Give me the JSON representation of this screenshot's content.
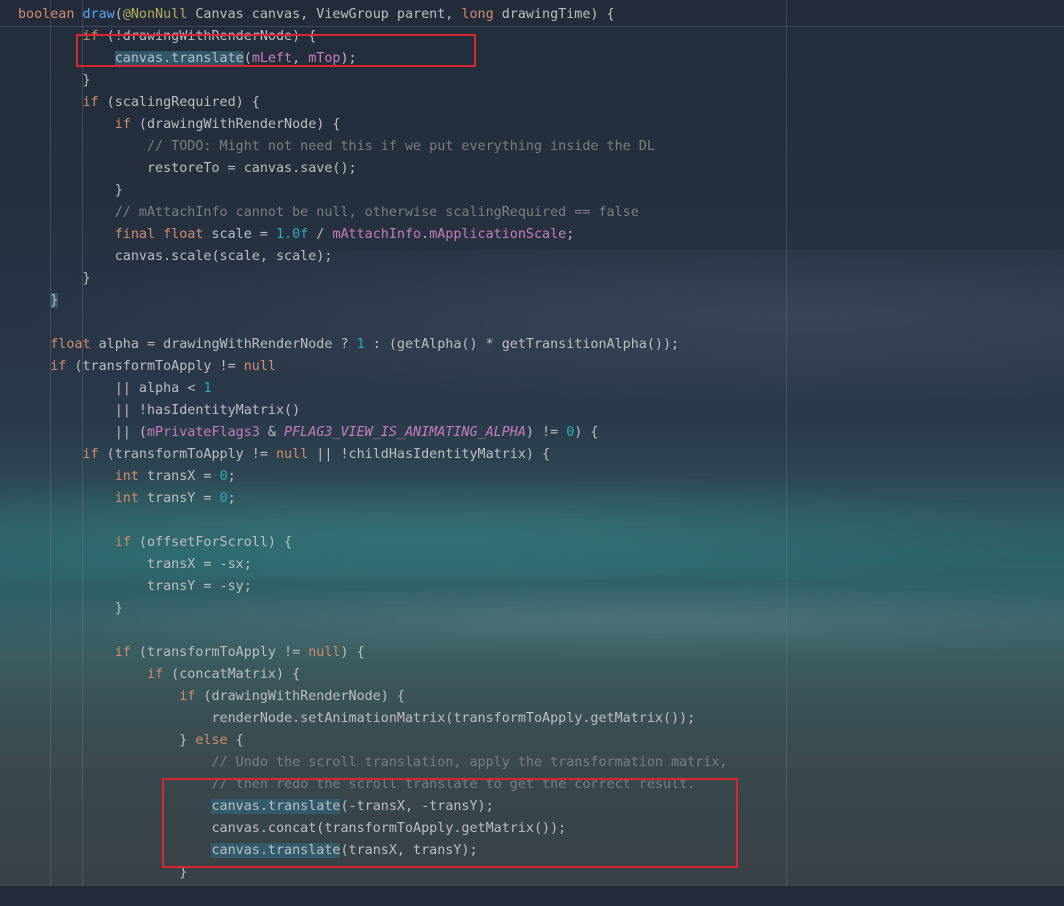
{
  "lines": [
    [
      [
        "kw",
        "boolean "
      ],
      [
        "fn",
        "draw"
      ],
      [
        "p",
        "("
      ],
      [
        "an",
        "@NonNull"
      ],
      [
        "p",
        " Canvas canvas, ViewGroup parent, "
      ],
      [
        "kw",
        "long"
      ],
      [
        "p",
        " drawingTime) {"
      ]
    ],
    [
      [
        "p",
        "        "
      ],
      [
        "kw",
        "if"
      ],
      [
        "p",
        " (!drawingWithRenderNode) {"
      ]
    ],
    [
      [
        "p",
        "            "
      ],
      [
        "hl",
        "canvas.translate"
      ],
      [
        "p",
        "("
      ],
      [
        "fd",
        "mLeft"
      ],
      [
        "p",
        ", "
      ],
      [
        "fd",
        "mTop"
      ],
      [
        "p",
        ");"
      ]
    ],
    [
      [
        "p",
        "        }"
      ]
    ],
    [
      [
        "p",
        "        "
      ],
      [
        "kw",
        "if"
      ],
      [
        "p",
        " (scalingRequired) {"
      ]
    ],
    [
      [
        "p",
        "            "
      ],
      [
        "kw",
        "if"
      ],
      [
        "p",
        " (drawingWithRenderNode) {"
      ]
    ],
    [
      [
        "p",
        "                "
      ],
      [
        "cm",
        "// TODO: Might not need this if we put everything inside the DL"
      ]
    ],
    [
      [
        "p",
        "                restoreTo = canvas.save();"
      ]
    ],
    [
      [
        "p",
        "            }"
      ]
    ],
    [
      [
        "p",
        "            "
      ],
      [
        "cm",
        "// mAttachInfo cannot be null, otherwise scalingRequired == false"
      ]
    ],
    [
      [
        "p",
        "            "
      ],
      [
        "kw",
        "final float"
      ],
      [
        "p",
        " scale = "
      ],
      [
        "num",
        "1.0f"
      ],
      [
        "p",
        " / "
      ],
      [
        "fd",
        "mAttachInfo"
      ],
      [
        "p",
        "."
      ],
      [
        "fd",
        "mApplicationScale"
      ],
      [
        "p",
        ";"
      ]
    ],
    [
      [
        "p",
        "            canvas.scale(scale, scale);"
      ]
    ],
    [
      [
        "p",
        "        }"
      ]
    ],
    [
      [
        "p",
        "    "
      ],
      [
        "bh",
        "}"
      ]
    ],
    [
      [
        "p",
        ""
      ]
    ],
    [
      [
        "p",
        "    "
      ],
      [
        "kw",
        "float"
      ],
      [
        "p",
        " alpha = drawingWithRenderNode ? "
      ],
      [
        "num",
        "1"
      ],
      [
        "p",
        " : (getAlpha() * getTransitionAlpha());"
      ]
    ],
    [
      [
        "p",
        "    "
      ],
      [
        "kw",
        "if"
      ],
      [
        "p",
        " (transformToApply != "
      ],
      [
        "kw",
        "null"
      ]
    ],
    [
      [
        "p",
        "            || alpha < "
      ],
      [
        "num",
        "1"
      ]
    ],
    [
      [
        "p",
        "            || !hasIdentityMatrix()"
      ]
    ],
    [
      [
        "p",
        "            || ("
      ],
      [
        "fd",
        "mPrivateFlags3"
      ],
      [
        "p",
        " & "
      ],
      [
        "cn",
        "PFLAG3_VIEW_IS_ANIMATING_ALPHA"
      ],
      [
        "p",
        ") != "
      ],
      [
        "num",
        "0"
      ],
      [
        "p",
        ") {"
      ]
    ],
    [
      [
        "p",
        "        "
      ],
      [
        "kw",
        "if"
      ],
      [
        "p",
        " (transformToApply != "
      ],
      [
        "kw",
        "null"
      ],
      [
        "p",
        " || !childHasIdentityMatrix) {"
      ]
    ],
    [
      [
        "p",
        "            "
      ],
      [
        "kw",
        "int"
      ],
      [
        "p",
        " transX = "
      ],
      [
        "num",
        "0"
      ],
      [
        "p",
        ";"
      ]
    ],
    [
      [
        "p",
        "            "
      ],
      [
        "kw",
        "int"
      ],
      [
        "p",
        " transY = "
      ],
      [
        "num",
        "0"
      ],
      [
        "p",
        ";"
      ]
    ],
    [
      [
        "p",
        ""
      ]
    ],
    [
      [
        "p",
        "            "
      ],
      [
        "kw",
        "if"
      ],
      [
        "p",
        " (offsetForScroll) {"
      ]
    ],
    [
      [
        "p",
        "                transX = -sx;"
      ]
    ],
    [
      [
        "p",
        "                transY = -sy;"
      ]
    ],
    [
      [
        "p",
        "            }"
      ]
    ],
    [
      [
        "p",
        ""
      ]
    ],
    [
      [
        "p",
        "            "
      ],
      [
        "kw",
        "if"
      ],
      [
        "p",
        " (transformToApply != "
      ],
      [
        "kw",
        "null"
      ],
      [
        "p",
        ") {"
      ]
    ],
    [
      [
        "p",
        "                "
      ],
      [
        "kw",
        "if"
      ],
      [
        "p",
        " (concatMatrix) {"
      ]
    ],
    [
      [
        "p",
        "                    "
      ],
      [
        "kw",
        "if"
      ],
      [
        "p",
        " (drawingWithRenderNode) {"
      ]
    ],
    [
      [
        "p",
        "                        renderNode.setAnimationMatrix(transformToApply.getMatrix());"
      ]
    ],
    [
      [
        "p",
        "                    } "
      ],
      [
        "kw",
        "else"
      ],
      [
        "p",
        " {"
      ]
    ],
    [
      [
        "p",
        "                        "
      ],
      [
        "cm",
        "// Undo the scroll translation, apply the transformation matrix,"
      ]
    ],
    [
      [
        "p",
        "                        "
      ],
      [
        "cm",
        "// then redo the scroll translate to get the correct result."
      ]
    ],
    [
      [
        "p",
        "                        "
      ],
      [
        "hl",
        "canvas.translate"
      ],
      [
        "p",
        "(-transX, -transY);"
      ]
    ],
    [
      [
        "p",
        "                        canvas.concat(transformToApply.getMatrix());"
      ]
    ],
    [
      [
        "p",
        "                        "
      ],
      [
        "hl",
        "canvas.translate"
      ],
      [
        "p",
        "(transX, transY);"
      ]
    ],
    [
      [
        "p",
        "                    }"
      ]
    ],
    [
      [
        "p",
        "                    "
      ],
      [
        "p",
        "                    "
      ]
    ]
  ],
  "colors": {
    "keyword": "#cf8e6d",
    "function": "#56a8f5",
    "field": "#c77dbb",
    "number": "#2aacb8",
    "comment": "#7a7e85",
    "annotation": "#b3ae60",
    "plain": "#bcbec4",
    "highlight_box": "#d9272e"
  }
}
